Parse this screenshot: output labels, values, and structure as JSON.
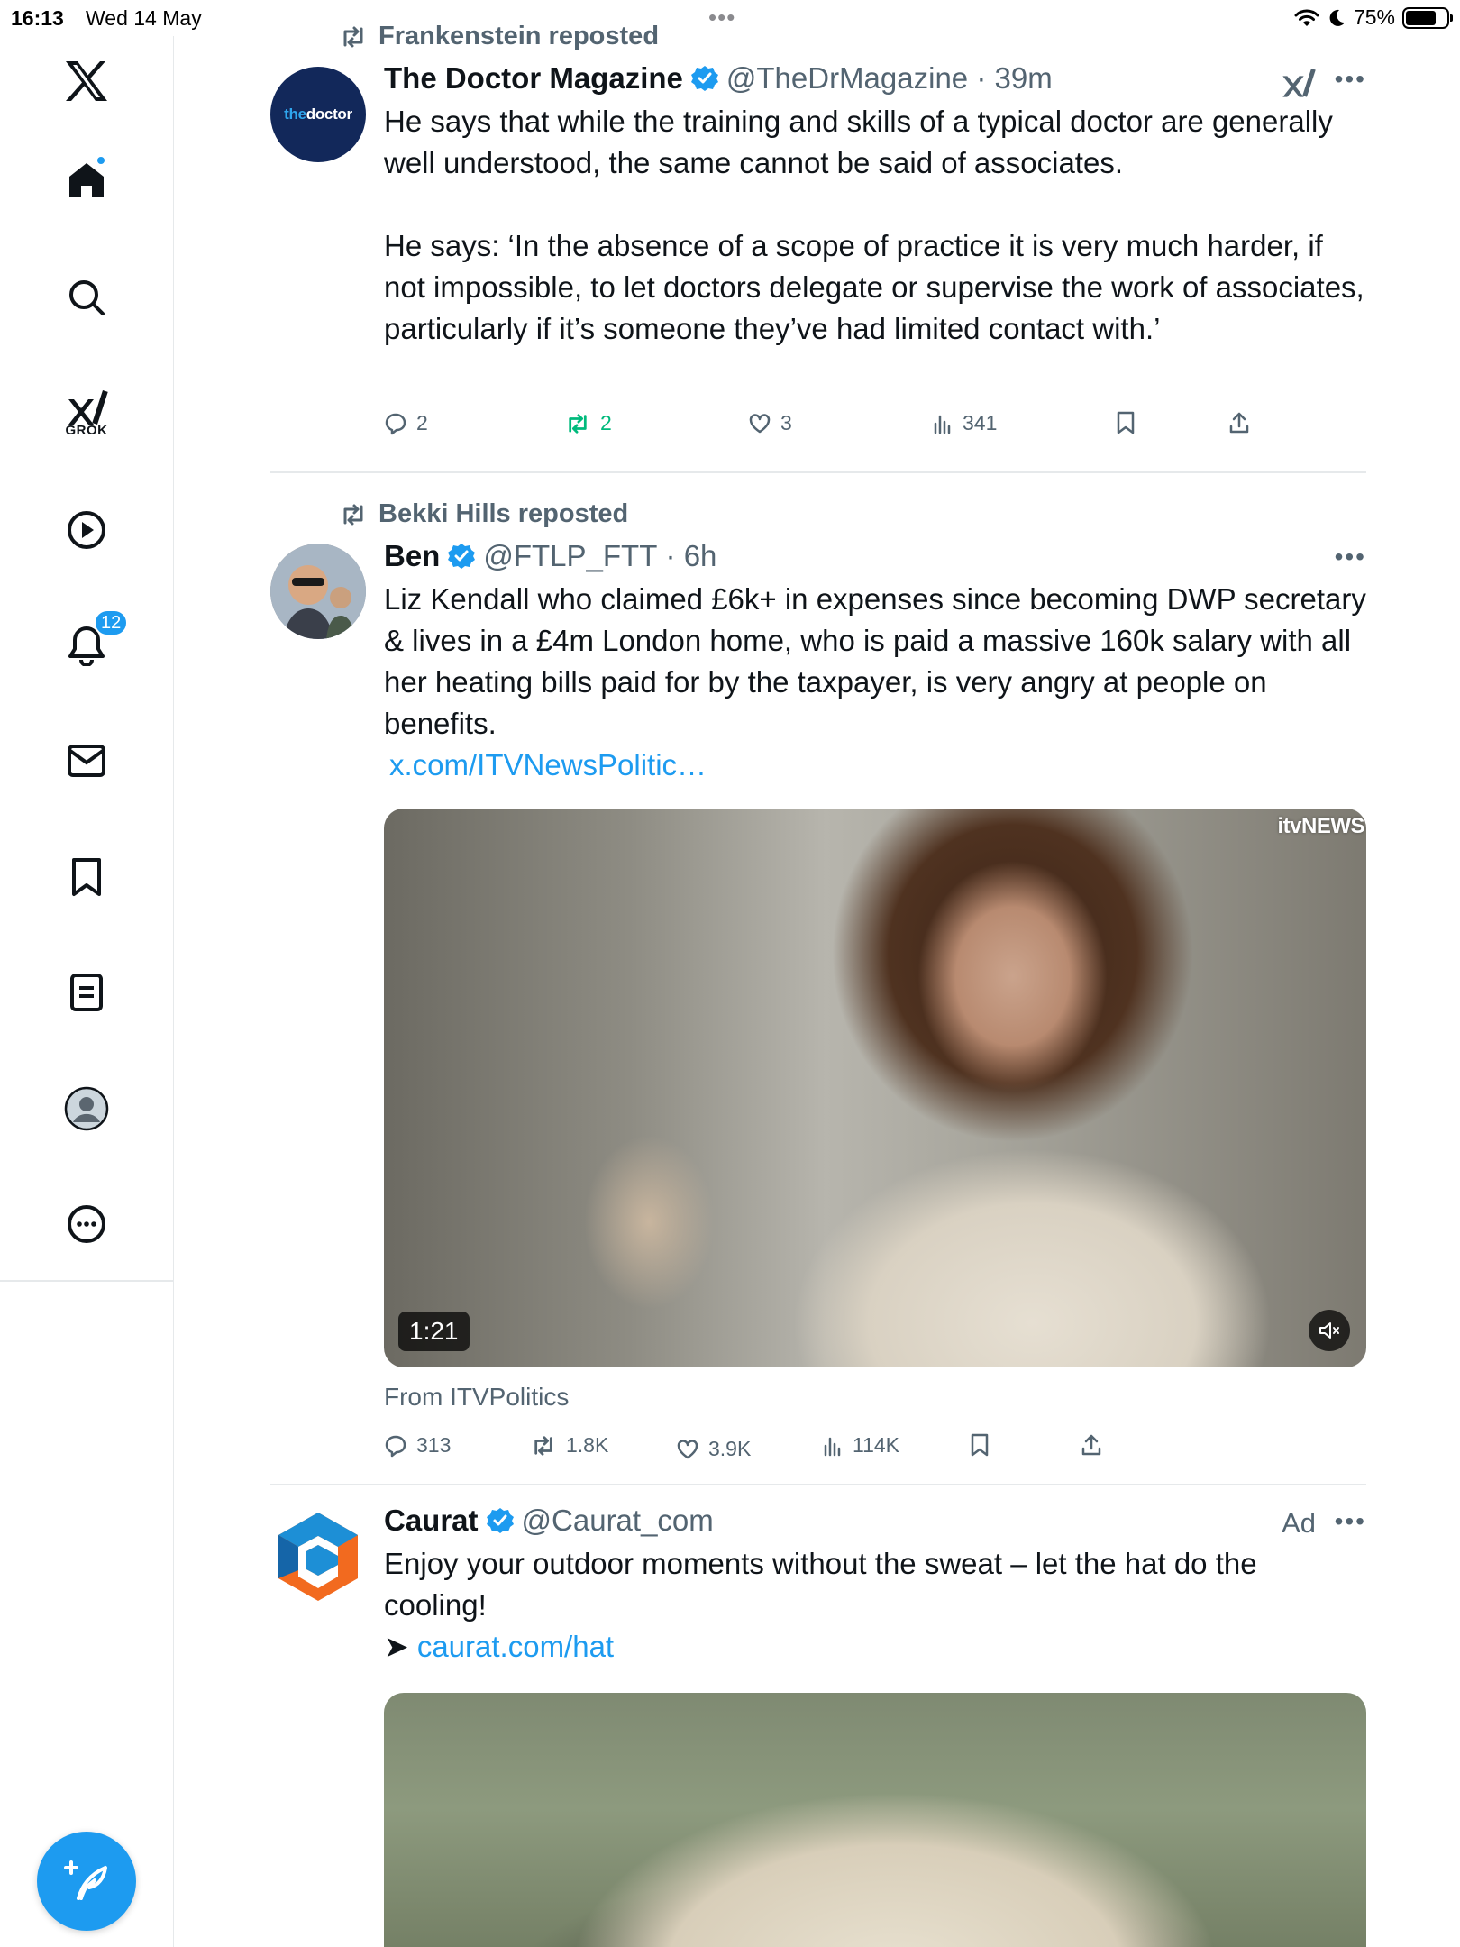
{
  "status_bar": {
    "time": "16:13",
    "date": "Wed 14 May",
    "battery": "75%",
    "battery_level": 0.75
  },
  "sidebar": {
    "grok_label": "GROK",
    "notifications_count": "12",
    "items": [
      "home",
      "explore",
      "grok",
      "video",
      "notifications",
      "messages",
      "bookmarks",
      "lists",
      "profile",
      "more"
    ]
  },
  "tweets": [
    {
      "reposted_by": "Frankenstein reposted",
      "avatar_text_a": "the",
      "avatar_text_b": "doctor",
      "name": "The Doctor Magazine",
      "handle": "@TheDrMagazine",
      "time": "39m",
      "text": "He says that while the training and skills of a typical doctor are generally well understood, the same cannot be said of associates.\n\nHe says: ‘In the absence of a scope of practice it is very much harder, if not impossible, to let doctors delegate or supervise the work of associates, particularly if it’s someone they’ve had limited contact with.’",
      "replies": "2",
      "reposts": "2",
      "likes": "3",
      "views": "341"
    },
    {
      "reposted_by": "Bekki Hills reposted",
      "name": "Ben",
      "handle": "@FTLP_FTT",
      "time": "6h",
      "text": "Liz Kendall who claimed £6k+ in expenses since becoming DWP secretary & lives in a £4m London home, who is paid a massive 160k salary with all her heating bills paid for by the taxpayer, is very angry at people on benefits.",
      "link": "x.com/ITVNewsPolitic…",
      "video_duration": "1:21",
      "watermark": "itvNEWS",
      "from": "From ITVPolitics",
      "replies": "313",
      "reposts": "1.8K",
      "likes": "3.9K",
      "views": "114K"
    },
    {
      "name": "Caurat",
      "handle": "@Caurat_com",
      "ad_label": "Ad",
      "text": "Enjoy your outdoor moments without the sweat – let the hat do the cooling!",
      "arrow": "➤",
      "link": "caurat.com/hat"
    }
  ],
  "colors": {
    "accent": "#1d9bf0",
    "repost_green": "#00ba7c",
    "muted": "#536471"
  }
}
